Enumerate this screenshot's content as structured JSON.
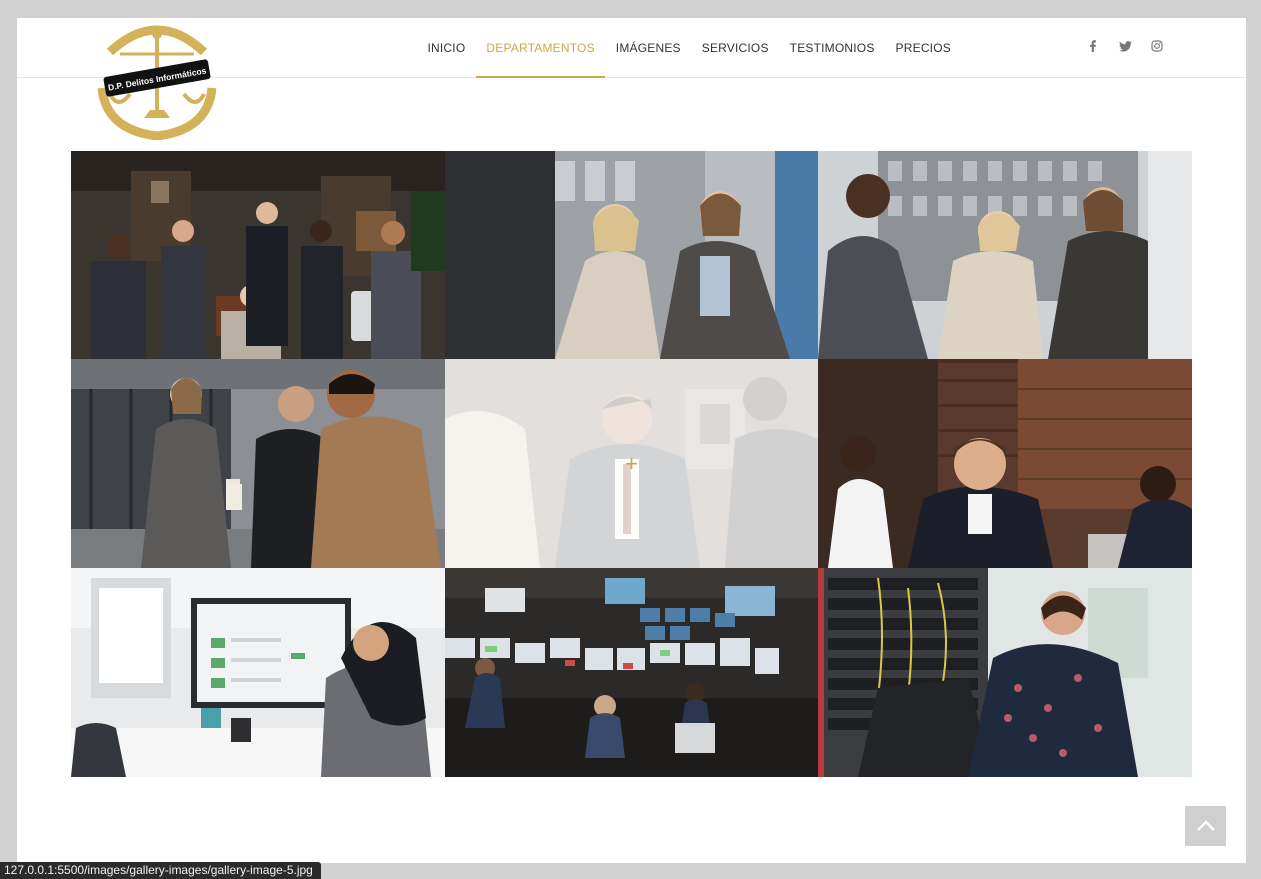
{
  "brand": {
    "logo_text": "D.P. Delitos Informáticos"
  },
  "nav": {
    "items": [
      {
        "label": "INICIO"
      },
      {
        "label": "DEPARTAMENTOS"
      },
      {
        "label": "IMÁGENES"
      },
      {
        "label": "SERVICIOS"
      },
      {
        "label": "TESTIMONIOS"
      },
      {
        "label": "PRECIOS"
      }
    ],
    "active": "DEPARTAMENTOS",
    "accent_color": "#c9a84c"
  },
  "social": [
    "facebook-icon",
    "twitter-icon",
    "instagram-icon"
  ],
  "gallery": {
    "hovered_tile": 5,
    "hover_icon": "+",
    "tiles": [
      {
        "subject": "team-portrait-office"
      },
      {
        "subject": "two-women-talking"
      },
      {
        "subject": "colleagues-outdoor"
      },
      {
        "subject": "business-people-walking"
      },
      {
        "subject": "man-in-suit-talking"
      },
      {
        "subject": "meeting-at-laptops"
      },
      {
        "subject": "woman-at-computer"
      },
      {
        "subject": "control-room"
      },
      {
        "subject": "server-rack-technician"
      }
    ]
  },
  "back_to_top": {
    "icon": "chevron-up-icon"
  },
  "status_bar": {
    "url": "127.0.0.1:5500/images/gallery-images/gallery-image-5.jpg"
  }
}
